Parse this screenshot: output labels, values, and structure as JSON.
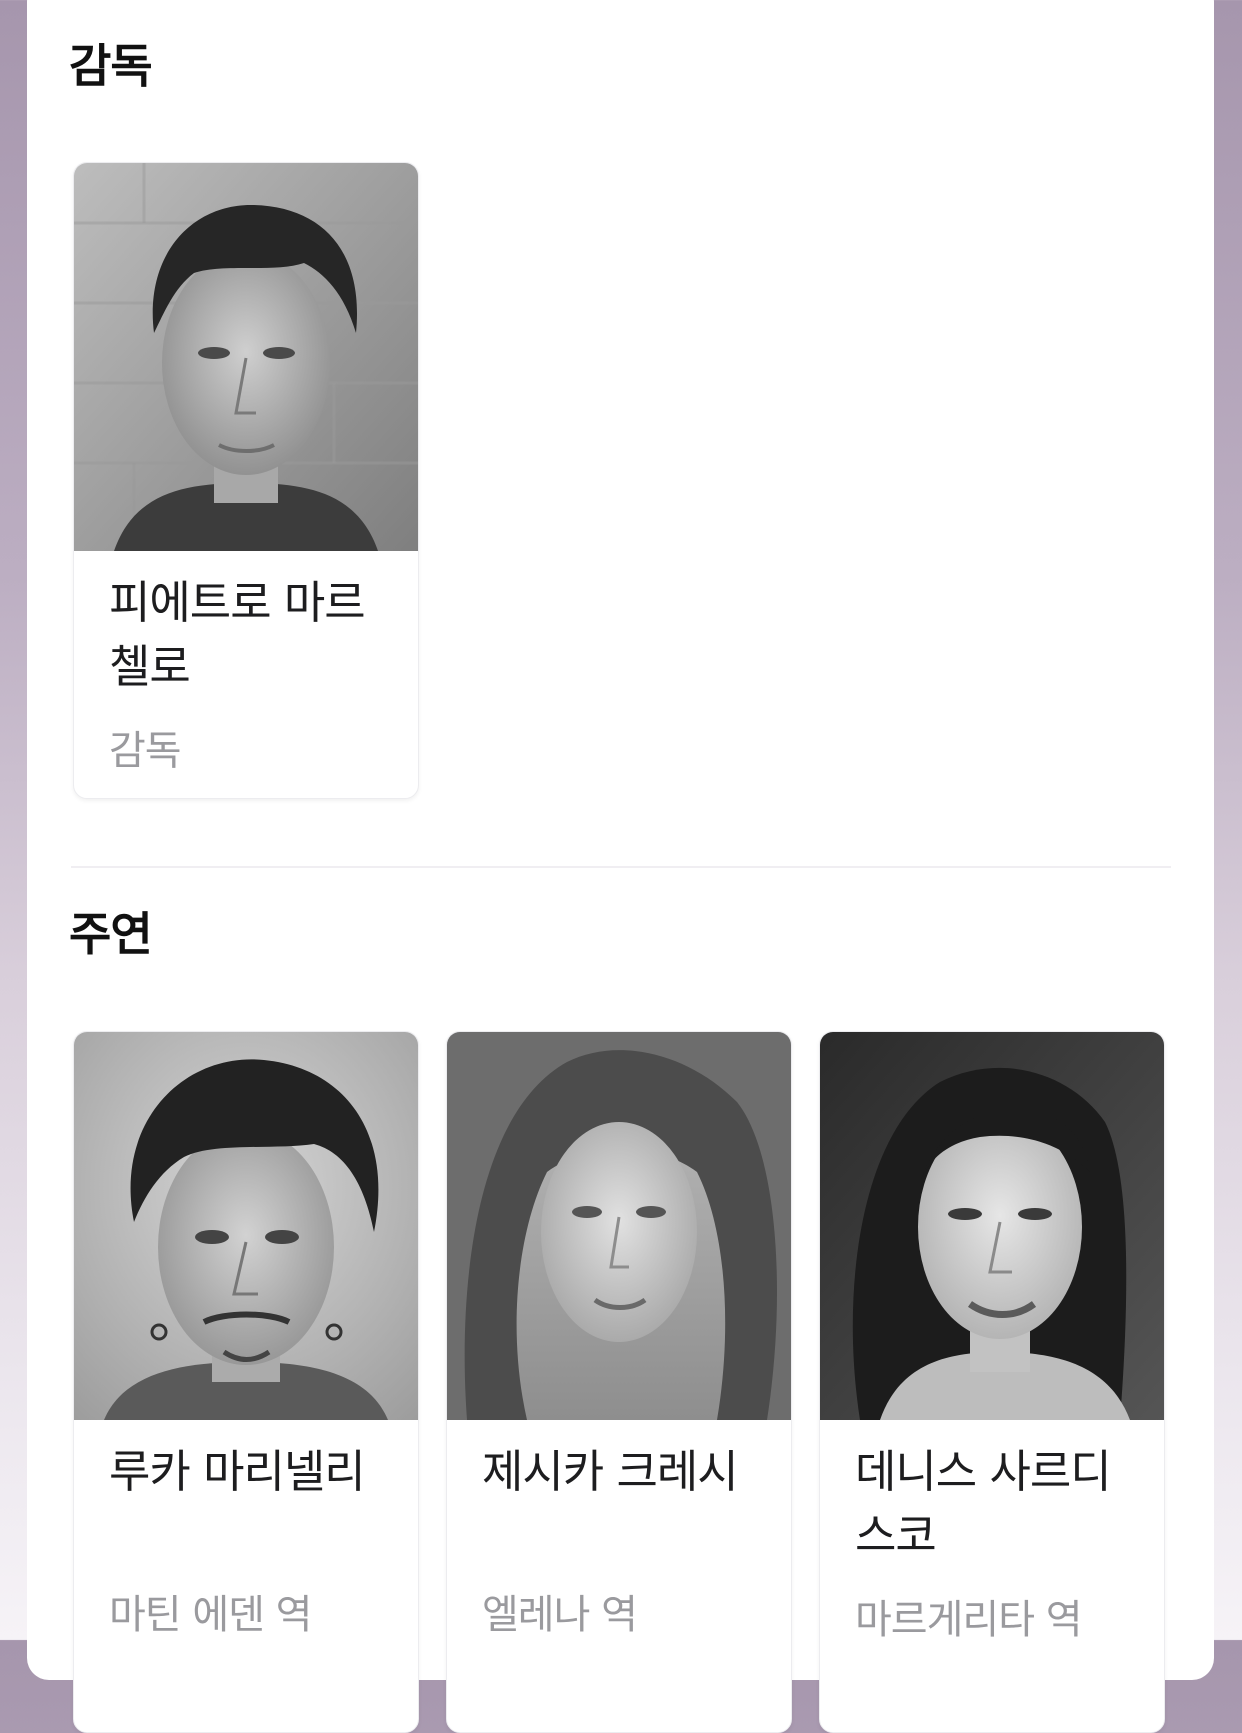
{
  "directors": {
    "title": "감독",
    "items": [
      {
        "name": "피에트로 마르 첼로",
        "role": "감독"
      }
    ]
  },
  "cast": {
    "title": "주연",
    "items": [
      {
        "name": "루카 마리넬리",
        "role": "마틴 에덴 역"
      },
      {
        "name": "제시카 크레시",
        "role": "엘레나 역"
      },
      {
        "name": "데니스 사르디 스코",
        "role": "마르게리타 역"
      }
    ]
  }
}
